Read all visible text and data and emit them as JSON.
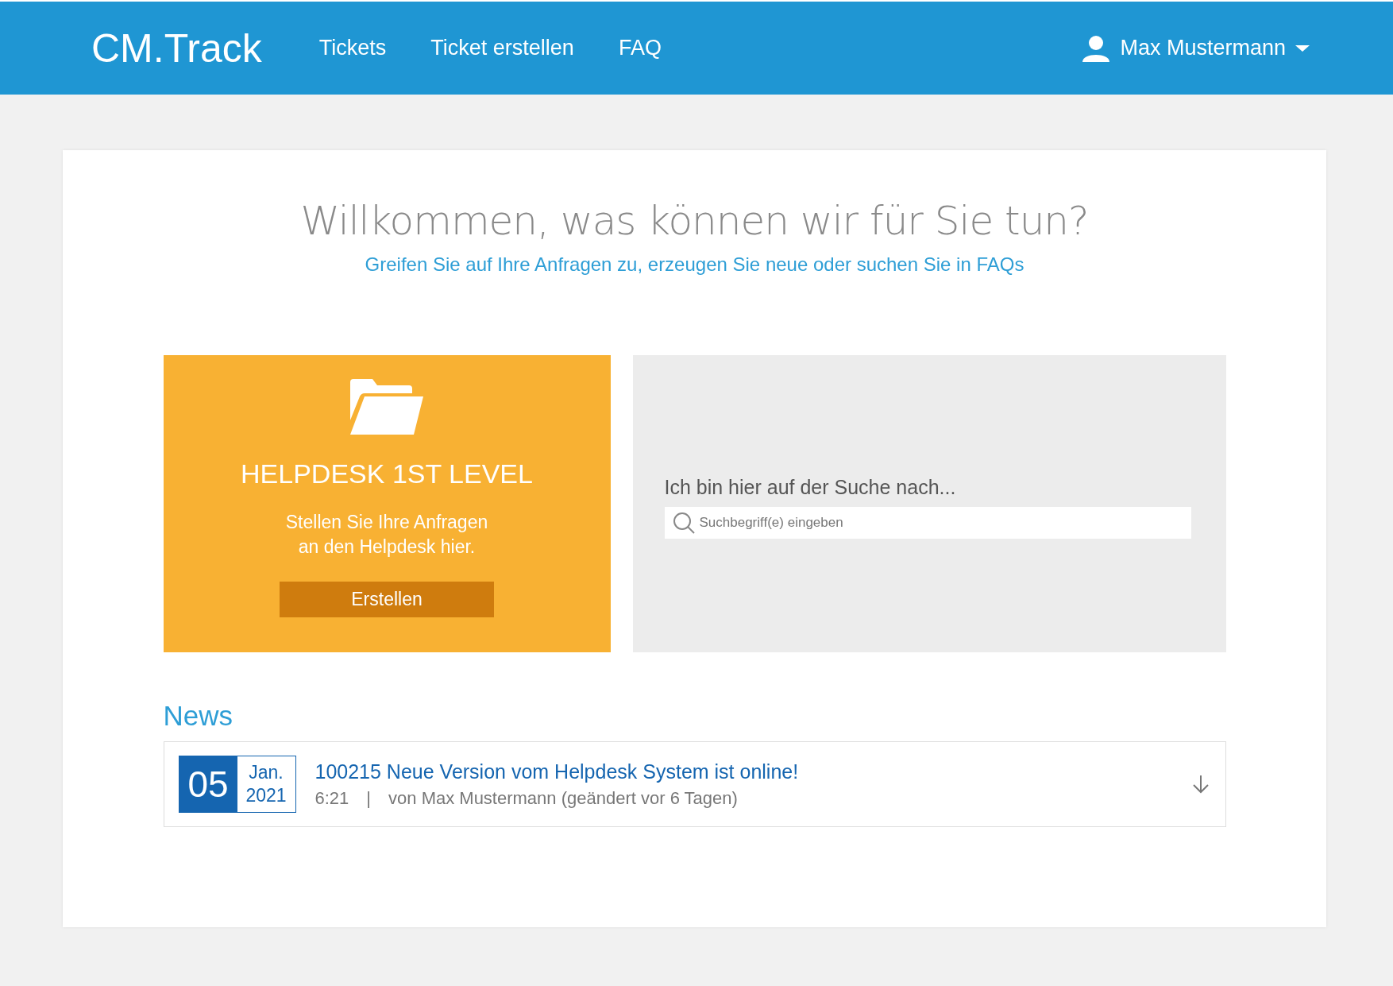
{
  "header": {
    "logo": "CM.Track",
    "nav": [
      {
        "label": "Tickets"
      },
      {
        "label": "Ticket erstellen"
      },
      {
        "label": "FAQ"
      }
    ],
    "user": "Max Mustermann"
  },
  "welcome": {
    "title": "Willkommen, was können wir für Sie tun?",
    "subtitle": "Greifen Sie auf Ihre Anfragen zu, erzeugen Sie neue oder suchen Sie in FAQs"
  },
  "helpdesk_card": {
    "title": "HELPDESK 1ST LEVEL",
    "text_lines": [
      "Stellen Sie Ihre Anfragen",
      "an den Helpdesk hier."
    ],
    "button": "Erstellen"
  },
  "search_card": {
    "label": "Ich bin hier auf der Suche nach...",
    "placeholder": "Suchbegriff(e) eingeben"
  },
  "news": {
    "heading": "News",
    "items": [
      {
        "day": "05",
        "month": "Jan.",
        "year": "2021",
        "title": "100215 Neue Version vom Helpdesk System ist online!",
        "time": "6:21",
        "separator": "|",
        "meta": "von Max Mustermann (geändert vor 6 Tagen)"
      }
    ]
  }
}
